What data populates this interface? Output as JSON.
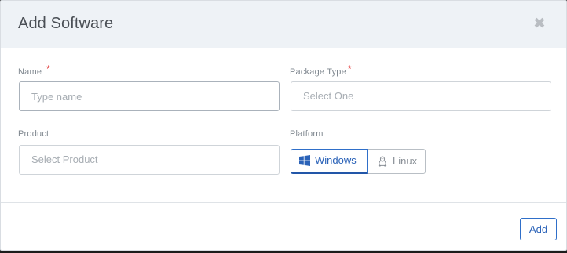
{
  "dialog": {
    "title": "Add Software",
    "close_glyph": "✖"
  },
  "form": {
    "name": {
      "label": "Name",
      "required_mark": "*",
      "placeholder": "Type name",
      "value": ""
    },
    "package_type": {
      "label": "Package Type",
      "required_mark": "*",
      "placeholder": "Select One"
    },
    "product": {
      "label": "Product",
      "placeholder": "Select Product"
    },
    "platform": {
      "label": "Platform",
      "options": [
        {
          "label": "Windows",
          "icon": "windows-icon",
          "selected": true
        },
        {
          "label": "Linux",
          "icon": "linux-icon",
          "selected": false
        }
      ]
    }
  },
  "footer": {
    "add_label": "Add"
  },
  "colors": {
    "accent": "#2f6fc9",
    "required": "#e02424",
    "header_bg": "#eef2f6"
  }
}
